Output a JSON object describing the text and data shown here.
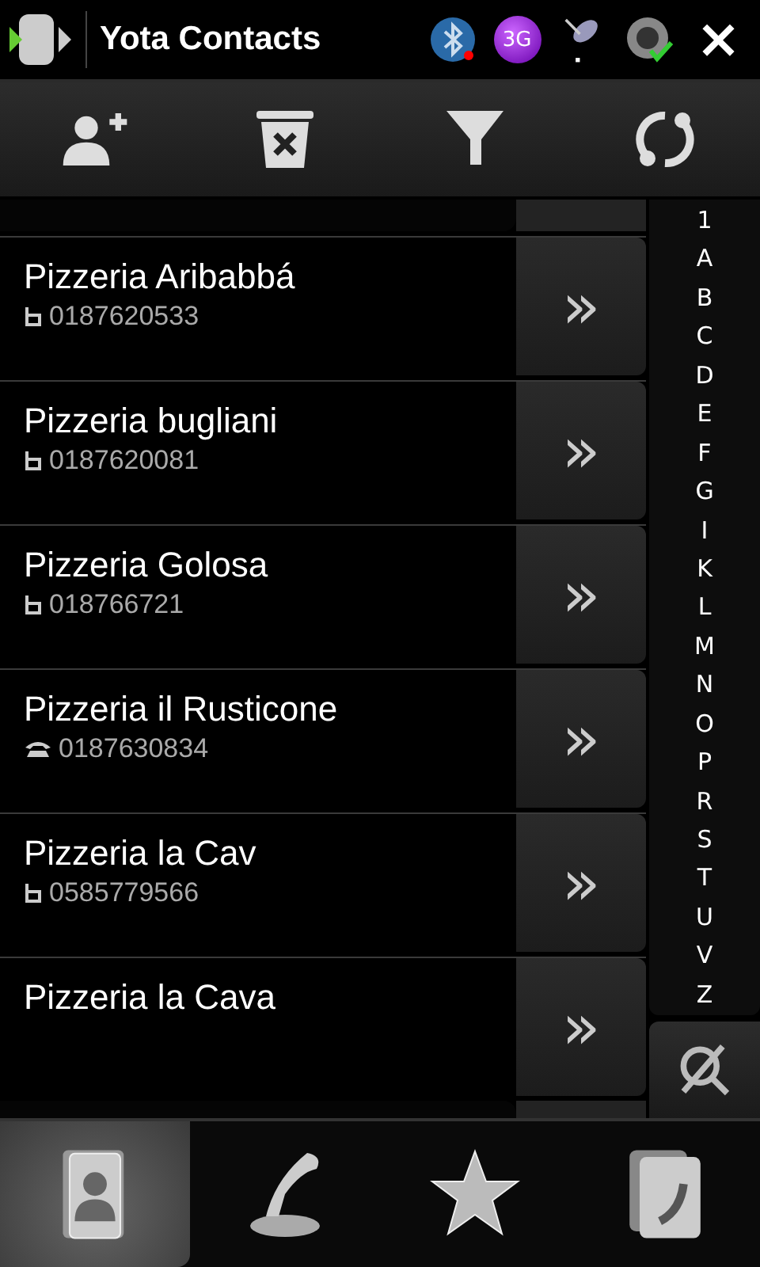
{
  "window": {
    "title": "Yota Contacts",
    "network_badge": "3G",
    "close": "×"
  },
  "toolbar": [
    {
      "kind": "add-contact"
    },
    {
      "kind": "delete"
    },
    {
      "kind": "filter"
    },
    {
      "kind": "sync"
    }
  ],
  "contacts": [
    {
      "name": "Pizzeria Aribabbá",
      "kind": "mobile",
      "phone": "0187620533"
    },
    {
      "name": "Pizzeria bugliani",
      "kind": "mobile",
      "phone": "0187620081"
    },
    {
      "name": "Pizzeria Golosa",
      "kind": "mobile",
      "phone": "018766721"
    },
    {
      "name": "Pizzeria il Rusticone",
      "kind": "landline",
      "phone": "0187630834"
    },
    {
      "name": "Pizzeria la Cav",
      "kind": "mobile",
      "phone": "0585779566"
    },
    {
      "name": "Pizzeria la Cava"
    }
  ],
  "chevron": "»",
  "index": [
    "1",
    "A",
    "B",
    "C",
    "D",
    "E",
    "F",
    "G",
    "I",
    "K",
    "L",
    "M",
    "N",
    "O",
    "P",
    "R",
    "S",
    "T",
    "U",
    "V",
    "Z"
  ],
  "tabs": [
    {
      "kind": "contacts",
      "selected": true
    },
    {
      "kind": "calls",
      "selected": false
    },
    {
      "kind": "favorites",
      "selected": false
    },
    {
      "kind": "call-log",
      "selected": false
    }
  ]
}
